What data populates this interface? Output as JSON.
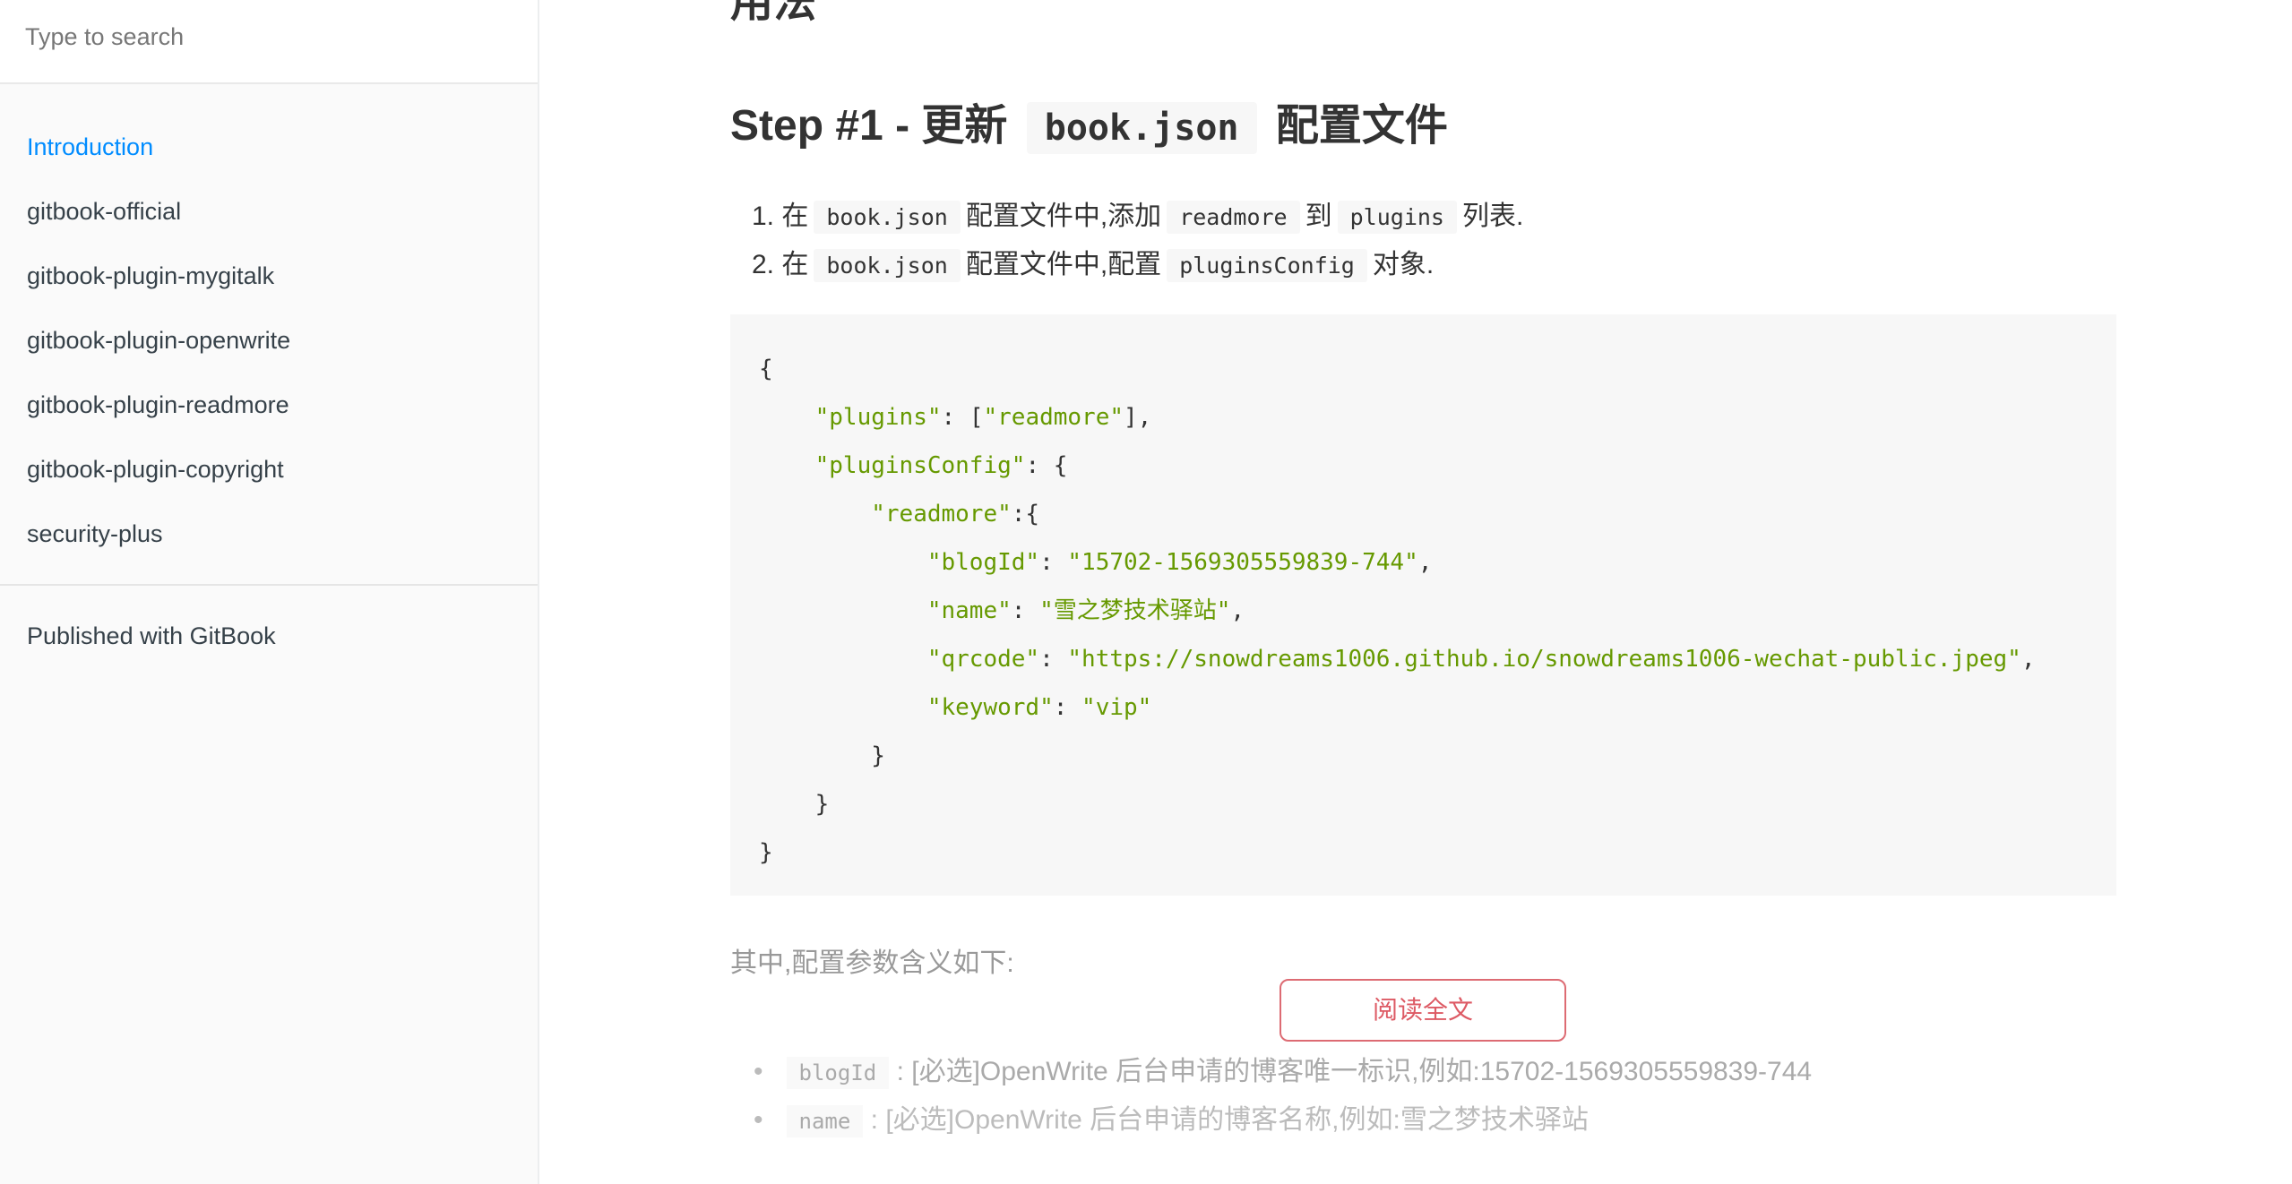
{
  "sidebar": {
    "search_placeholder": "Type to search",
    "items": [
      {
        "label": "Introduction",
        "active": true
      },
      {
        "label": "gitbook-official"
      },
      {
        "label": "gitbook-plugin-mygitalk"
      },
      {
        "label": "gitbook-plugin-openwrite"
      },
      {
        "label": "gitbook-plugin-readmore"
      },
      {
        "label": "gitbook-plugin-copyright"
      },
      {
        "label": "security-plus"
      }
    ],
    "published": "Published with GitBook",
    "accent": "#008cff"
  },
  "content": {
    "top_heading": "用法",
    "step_heading": {
      "prefix": "Step #1 - 更新",
      "code": "book.json",
      "suffix": "配置文件"
    },
    "steps": [
      {
        "num": "1.",
        "a": "在",
        "c1": "book.json",
        "b": "配置文件中,添加",
        "c2": "readmore",
        "d": "到",
        "c3": "plugins",
        "e": "列表."
      },
      {
        "num": "2.",
        "a": "在",
        "c1": "book.json",
        "b": "配置文件中,配置",
        "c2": "pluginsConfig",
        "e": "对象."
      }
    ],
    "code": {
      "l1": "{",
      "plugins_key": "\"plugins\"",
      "plugins_val": "\"readmore\"",
      "pc_key": "\"pluginsConfig\"",
      "rm_key": "\"readmore\"",
      "blogId_key": "\"blogId\"",
      "blogId_val": "\"15702-1569305559839-744\"",
      "name_key": "\"name\"",
      "name_val": "\"雪之梦技术驿站\"",
      "qrcode_key": "\"qrcode\"",
      "qrcode_val": "\"https://snowdreams1006.github.io/snowdreams1006-wechat-public.jpeg\"",
      "keyword_key": "\"keyword\"",
      "keyword_val": "\"vip\""
    },
    "params_intro": "其中,配置参数含义如下:",
    "params": [
      {
        "code": "blogId",
        "text": ": [必选]OpenWrite 后台申请的博客唯一标识,例如:15702-1569305559839-744"
      },
      {
        "code": "name",
        "text": ": [必选]OpenWrite 后台申请的博客名称,例如:雪之梦技术驿站"
      }
    ],
    "read_more_button": "阅读全文",
    "button_color": "#dd5a64",
    "string_color": "#669900"
  }
}
